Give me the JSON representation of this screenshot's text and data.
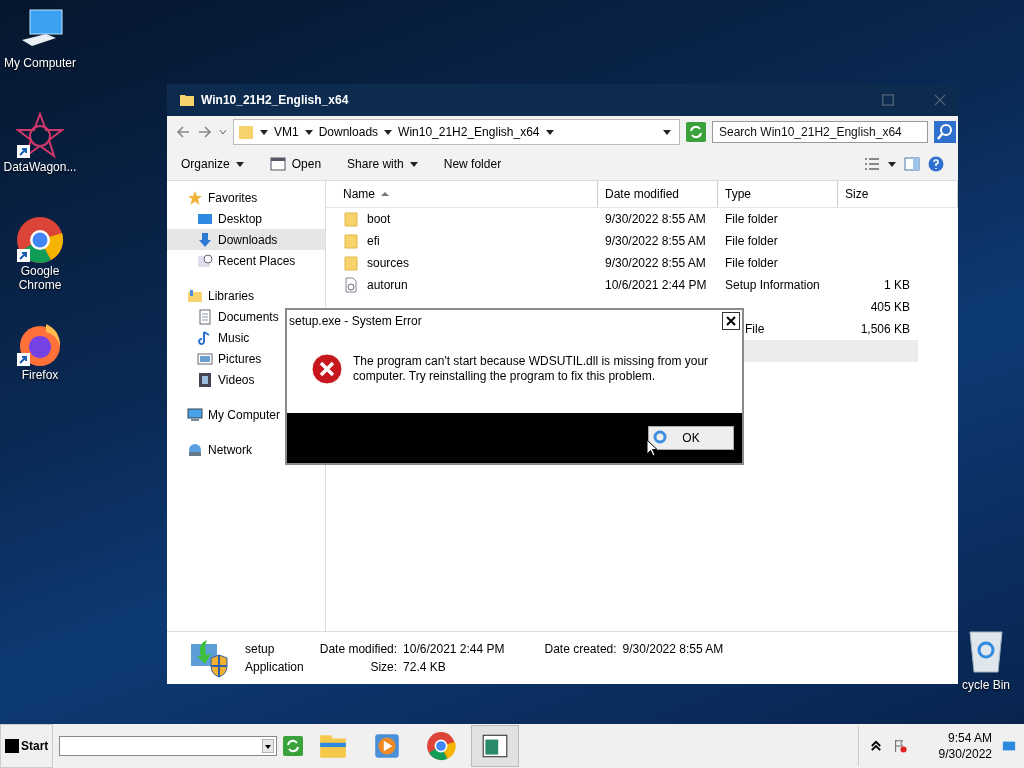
{
  "desktop_icons": [
    {
      "label": "My Computer",
      "kind": "computer",
      "shortcut": false
    },
    {
      "label": "DataWagon...",
      "kind": "star",
      "shortcut": true
    },
    {
      "label": "Google Chrome",
      "kind": "chrome",
      "shortcut": true
    },
    {
      "label": "Firefox",
      "kind": "firefox",
      "shortcut": true
    }
  ],
  "recycle_bin": {
    "label": "cycle Bin"
  },
  "explorer": {
    "title": "Win10_21H2_English_x64",
    "breadcrumb": [
      "VM1",
      "Downloads",
      "Win10_21H2_English_x64"
    ],
    "search": {
      "placeholder": "Search Win10_21H2_English_x64"
    },
    "toolbar": [
      {
        "label": "Organize",
        "kind": "menu"
      },
      {
        "label": "Open",
        "kind": "open"
      },
      {
        "label": "Share with",
        "kind": "menu"
      },
      {
        "label": "New folder",
        "kind": "plain"
      }
    ],
    "nav": [
      {
        "label": "Favorites",
        "kind": "star",
        "selected": false,
        "children": [
          {
            "label": "Desktop",
            "kind": "desktop",
            "selected": false
          },
          {
            "label": "Downloads",
            "kind": "download",
            "selected": true
          },
          {
            "label": "Recent Places",
            "kind": "recent",
            "selected": false
          }
        ]
      },
      {
        "label": "Libraries",
        "kind": "library",
        "selected": false,
        "children": [
          {
            "label": "Documents",
            "kind": "document",
            "selected": false
          },
          {
            "label": "Music",
            "kind": "music",
            "selected": false
          },
          {
            "label": "Pictures",
            "kind": "picture",
            "selected": false
          },
          {
            "label": "Videos",
            "kind": "video",
            "selected": false
          }
        ]
      },
      {
        "label": "My Computer",
        "kind": "computer",
        "selected": false
      },
      {
        "label": "Network",
        "kind": "network",
        "selected": false
      }
    ],
    "columns": [
      {
        "label": "Name",
        "sorted": true
      },
      {
        "label": "Date modified",
        "sorted": false
      },
      {
        "label": "Type",
        "sorted": false
      },
      {
        "label": "Size",
        "sorted": false
      }
    ],
    "rows": [
      {
        "kind": "folder",
        "name": "boot",
        "date": "9/30/2022 8:55 AM",
        "type": "File folder",
        "selected": false
      },
      {
        "kind": "folder",
        "name": "efi",
        "date": "9/30/2022 8:55 AM",
        "type": "File folder",
        "selected": false
      },
      {
        "kind": "folder",
        "name": "sources",
        "date": "9/30/2022 8:55 AM",
        "type": "File folder",
        "selected": false
      },
      {
        "kind": "settings",
        "name": "autorun",
        "date": "10/6/2021 2:44 PM",
        "type": "Setup Information",
        "size": "1 KB",
        "selected": false
      },
      {
        "size": "405 KB",
        "selected": false
      },
      {
        "type": "File",
        "type_cut": true,
        "size": "1,506 KB",
        "selected": false
      },
      {
        "selected": true
      }
    ],
    "details": {
      "name": "setup",
      "type": "Application",
      "fields": [
        {
          "label": "Date modified:",
          "value": "10/6/2021 2:44 PM"
        },
        {
          "label": "Date created:",
          "value": "9/30/2022 8:55 AM"
        },
        {
          "label": "Size:",
          "value": "72.4 KB"
        }
      ]
    }
  },
  "dialog": {
    "title": "setup.exe - System Error",
    "message": "The program can't start because WDSUTIL.dll is missing from your computer. Try reinstalling the program to fix this problem.",
    "button": "OK"
  },
  "taskbar": {
    "start": "Start",
    "apps": [
      {
        "kind": "folder",
        "active": false
      },
      {
        "kind": "media",
        "active": false
      },
      {
        "kind": "chrome",
        "active": false
      },
      {
        "kind": "window",
        "active": true
      }
    ],
    "time": "9:54 AM",
    "date": "9/30/2022"
  }
}
